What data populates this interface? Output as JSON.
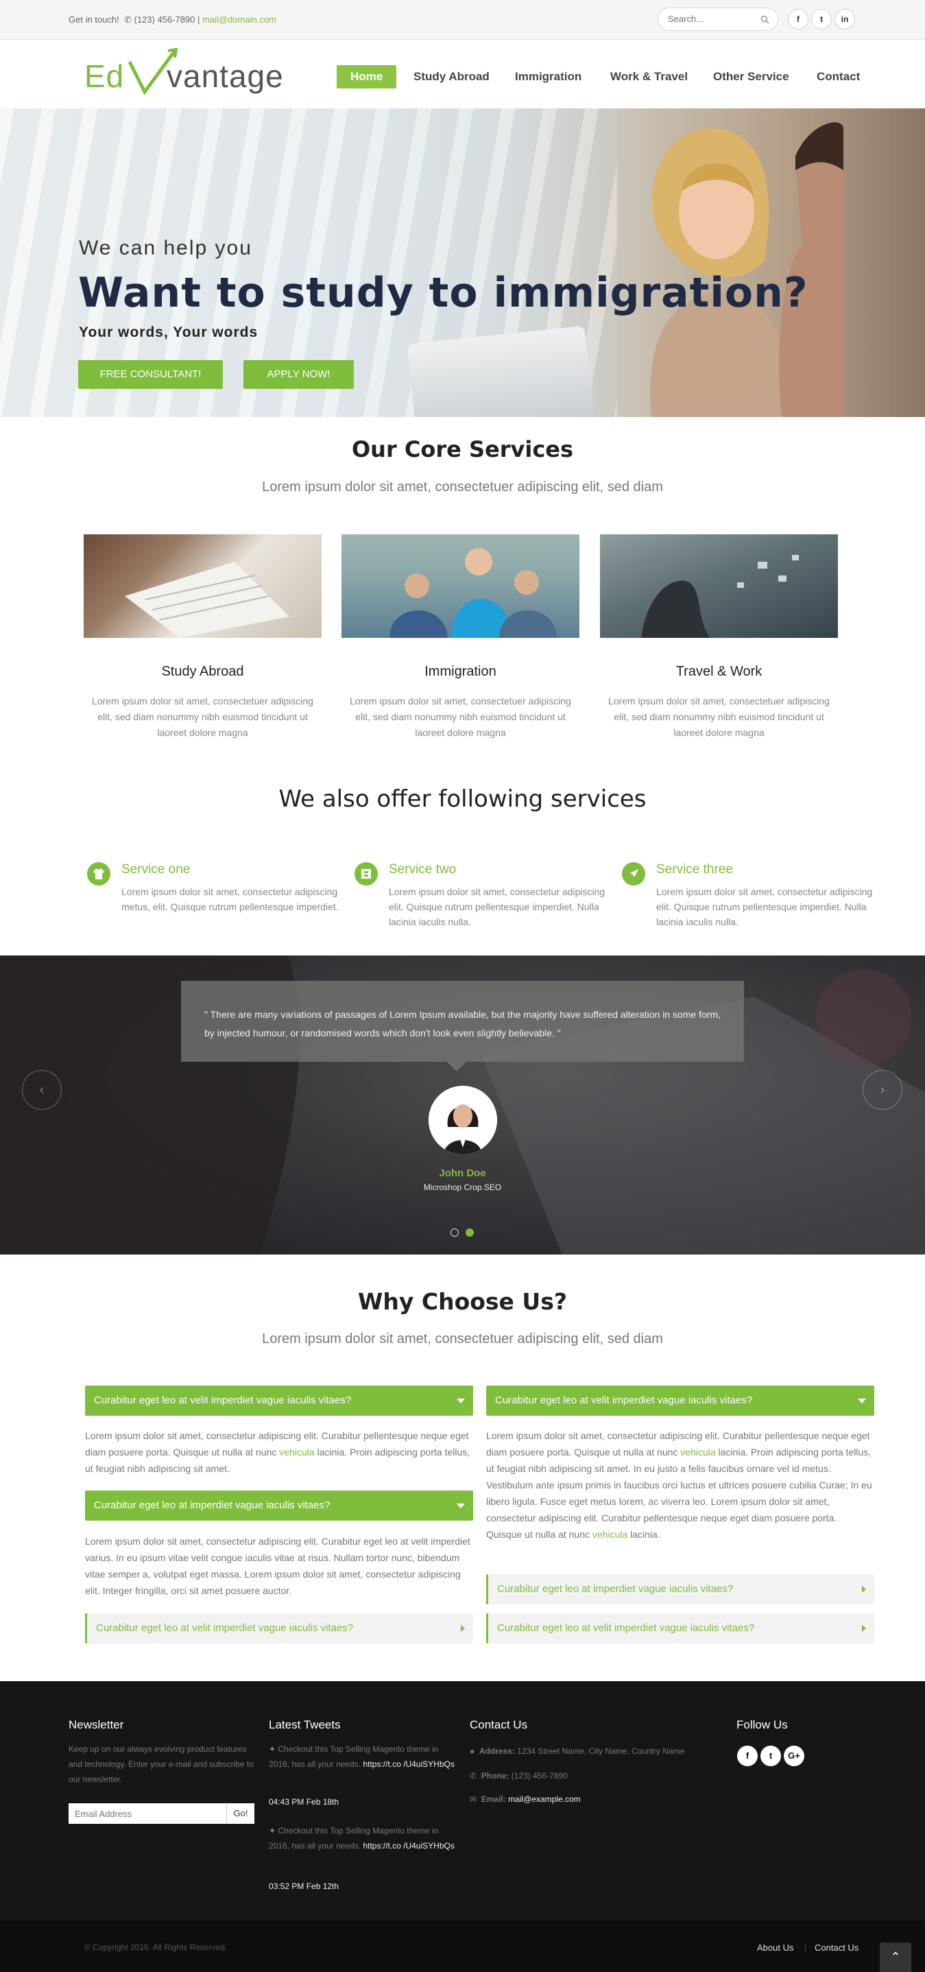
{
  "topbar": {
    "get_in_touch": "Get in touch!",
    "phone": "(123) 456-7890",
    "separator": "|",
    "email": "mail@domain.com",
    "search_placeholder": "Search...",
    "social": [
      "f",
      "t",
      "in"
    ]
  },
  "logo": {
    "part1": "Ed",
    "part2": "vantage"
  },
  "nav": {
    "items": [
      "Home",
      "Study Abroad",
      "Immigration",
      "Work & Travel",
      "Other Service",
      "Contact"
    ],
    "active": "Home"
  },
  "hero": {
    "subtitle": "We can help you",
    "title": "Want to study to immigration?",
    "tagline": "Your words, Your words",
    "btn_consult": "FREE CONSULTANT!",
    "btn_apply": "APPLY NOW!"
  },
  "core": {
    "title": "Our Core Services",
    "lead": "Lorem ipsum dolor sit amet, consectetuer adipiscing elit, sed diam",
    "services": [
      {
        "title": "Study Abroad",
        "text": "Lorem ipsum dolor sit amet, consectetuer adipiscing elit, sed diam nonummy nibh euismod tincidunt ut laoreet dolore magna"
      },
      {
        "title": "Immigration",
        "text": "Lorem ipsum dolor sit amet, consectetuer adipiscing elit, sed diam nonummy nibh euismod tincidunt ut laoreet dolore magna"
      },
      {
        "title": "Travel & Work",
        "text": "Lorem ipsum dolor sit amet, consectetuer adipiscing elit, sed diam nonummy nibh euismod tincidunt ut laoreet dolore magna"
      }
    ]
  },
  "offer": {
    "title": "We also offer following services",
    "items": [
      {
        "title": "Service one",
        "icon": "shirt-icon",
        "text": "Lorem ipsum dolor sit amet, consectetur adipiscing metus, elit. Quisque rutrum pellentesque imperdiet."
      },
      {
        "title": "Service two",
        "icon": "film-icon",
        "text": "Lorem ipsum dolor sit amet, consectetur adipiscing elit. Quisque rutrum pellentesque imperdiet. Nulla lacinia iaculis nulla."
      },
      {
        "title": "Service three",
        "icon": "rocket-icon",
        "text": "Lorem ipsum dolor sit amet, consectetur adipiscing elit. Quisque rutrum pellentesque imperdiet. Nulla lacinia iaculis nulla."
      }
    ]
  },
  "testimonial": {
    "quote": "\" There are many variations of passages of Lorem Ipsum available, but the majority have suffered alteration in some form, by injected humour, or randomised words which don't look even slightly believable. \"",
    "name": "John Doe",
    "role": "Microshop Crop.SEO",
    "prev": "‹",
    "next": "›"
  },
  "why": {
    "title": "Why Choose Us?",
    "lead": "Lorem ipsum dolor sit amet, consectetuer adipiscing elit, sed diam",
    "left": {
      "acc1_title": "Curabitur eget leo at velit imperdiet vague iaculis vitaes?",
      "acc1_body_a": "Lorem ipsum dolor sit amet, consectetur adipiscing elit. Curabitur pellentesque neque eget diam posuere porta. Quisque ut nulla at nunc ",
      "acc1_link": "vehicula",
      "acc1_body_b": " lacinia. Proin adipiscing porta tellus, ut feugiat nibh adipiscing sit amet.",
      "acc2_title": "Curabitur eget leo at imperdiet vague iaculis vitaes?",
      "acc2_body": "Lorem ipsum dolor sit amet, consectetur adipiscing elit. Curabitur eget leo at velit imperdiet varius. In eu ipsum vitae velit congue iaculis vitae at risus. Nullam tortor nunc, bibendum vitae semper a, volutpat eget massa. Lorem ipsum dolor sit amet, consectetur adipiscing elit. Integer fringilla, orci sit amet posuere auctor.",
      "acc3_title": "Curabitur eget leo at velit imperdiet vague iaculis vitaes?"
    },
    "right": {
      "acc1_title": "Curabitur eget leo at velit imperdiet vague iaculis vitaes?",
      "acc1_body_a": "Lorem ipsum dolor sit amet, consectetur adipiscing elit. Curabitur pellentesque neque eget diam posuere porta. Quisque ut nulla at nunc ",
      "acc1_link1": "vehicula",
      "acc1_body_b": " lacinia. Proin adipiscing porta tellus, ut feugiat nibh adipiscing sit amet. In eu justo a felis faucibus ornare vel id metus. Vestibulum ante ipsum primis in faucibus orci luctus et ultrices posuere cubilia Curae; In eu libero ligula. Fusce eget metus lorem, ac viverra leo. Lorem ipsum dolor sit amet, consectetur adipiscing elit. Curabitur pellentesque neque eget diam posuere porta. Quisque ut nulla at nunc ",
      "acc1_link2": "vehicula",
      "acc1_body_c": " lacinia.",
      "acc2_title": "Curabitur eget leo at imperdiet vague iaculis vitaes?",
      "acc3_title": "Curabitur eget leo at velit imperdiet vague iaculis vitaes?"
    }
  },
  "footer": {
    "newsletter_title": "Newsletter",
    "newsletter_text": "Keep up on our always evolving product features and technology. Enter your e-mail and subscribe to our newsletter.",
    "newsletter_placeholder": "Email Address",
    "newsletter_btn": "Go!",
    "tweets_title": "Latest Tweets",
    "tweet1_text": "Checkout this Top Selling Magento theme in 2016, has all your needs.",
    "tweet1_link": "https://t.co /U4uiSYHbQs",
    "tweet1_time": "04:43 PM Feb 18th",
    "tweet2_text": "Checkout this Top Selling Magento theme in 2016, has all your needs.",
    "tweet2_link": "https://t.co /U4uiSYHbQs",
    "tweet2_time": "03:52 PM Feb 12th",
    "contact_title": "Contact Us",
    "address_label": "Address:",
    "address": "1234 Street Name, City Name, Country Name",
    "phone_label": "Phone:",
    "phone": "(123) 456-7890",
    "email_label": "Email:",
    "email": "mail@example.com",
    "follow_title": "Follow Us",
    "social": [
      "f",
      "t",
      "G+"
    ],
    "copyright": "© Copyright 2016. All Rights Reserved.",
    "about": "About Us",
    "contact": "Contact Us",
    "to_top": "⌃"
  },
  "colors": {
    "accent": "#7fbd3c",
    "footer": "#161616",
    "heading": "#1f2a44"
  }
}
